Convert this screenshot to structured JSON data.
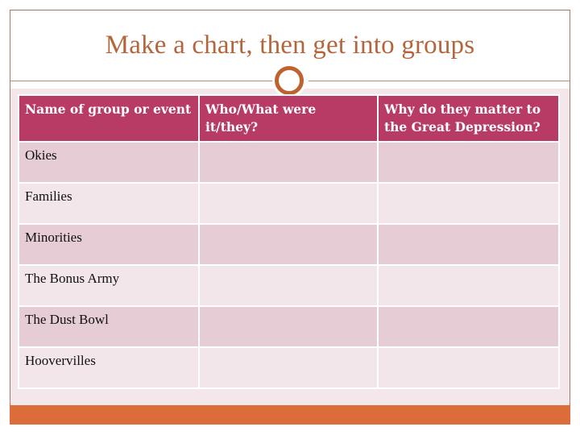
{
  "slide": {
    "title": "Make a chart, then get into groups",
    "colors": {
      "title": "#b4653c",
      "header_fill": "#b83b66",
      "row_odd_fill": "#e6ccd4",
      "row_even_fill": "#f2e6eb",
      "accent_bar": "#dc6c3a",
      "ring": "#c0622e"
    }
  },
  "table": {
    "headers": [
      "Name of group or event",
      "Who/What were it/they?",
      "Why do they matter to the Great Depression?"
    ],
    "rows": [
      {
        "name": "Okies",
        "who": "",
        "why": ""
      },
      {
        "name": "Families",
        "who": "",
        "why": ""
      },
      {
        "name": "Minorities",
        "who": "",
        "why": ""
      },
      {
        "name": "The Bonus Army",
        "who": "",
        "why": ""
      },
      {
        "name": "The Dust Bowl",
        "who": "",
        "why": ""
      },
      {
        "name": "Hoovervilles",
        "who": "",
        "why": ""
      }
    ]
  },
  "icons": {
    "divider_ring": "ring-icon"
  }
}
